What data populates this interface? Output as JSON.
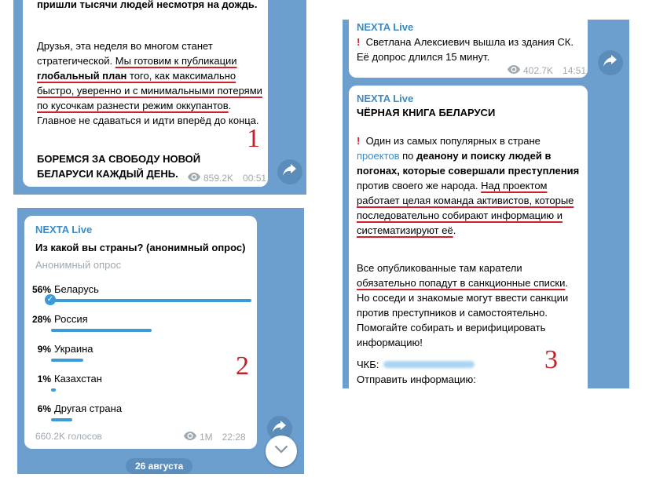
{
  "panel1": {
    "line_cut": "пришли тысячи людей несмотря на дождь.",
    "para1": {
      "t1": "Друзья, эта неделя во многом станет стратегической. ",
      "t2": "Мы готовим к публикации ",
      "t3": "глобальный план",
      "t4": " того, как максимально быстро, уверенно и с минимальными потерями по кусочкам разнести режим оккупантов",
      "t5": ". Главное не сдаваться и идти вперёд до конца."
    },
    "para2": "БОРЕМСЯ ЗА СВОБОДУ НОВОЙ БЕЛАРУСИ КАЖДЫЙ ДЕНЬ.",
    "views": "859.2K",
    "time": "00:51",
    "mark": "1"
  },
  "panel2": {
    "channel": "NEXTA Live",
    "question": "Из какой вы страны? (анонимный опрос)",
    "poll_type": "Анонимный опрос",
    "options": [
      {
        "pct": "56%",
        "label": "Беларусь",
        "value": 56
      },
      {
        "pct": "28%",
        "label": "Россия",
        "value": 28
      },
      {
        "pct": "9%",
        "label": "Украина",
        "value": 9
      },
      {
        "pct": "1%",
        "label": "Казахстан",
        "value": 1
      },
      {
        "pct": "6%",
        "label": "Другая страна",
        "value": 6
      }
    ],
    "votes": "660.2K голосов",
    "views": "1M",
    "time": "22:28",
    "date_pill": "26 августа",
    "mark": "2"
  },
  "panel3": {
    "msg1": {
      "channel": "NEXTA Live",
      "text": "Светлана Алексиевич вышла из здания СК. Её допрос длился 15 минут.",
      "views": "402.7K",
      "time": "14:51"
    },
    "msg2": {
      "channel": "NEXTA Live",
      "title": "ЧЁРНАЯ КНИГА БЕЛАРУСИ",
      "p1": {
        "t1": "Один из самых популярных в стране ",
        "t2": "проектов",
        "t3": " по ",
        "t4": "деанону и поиску людей в погонах, которые совершали преступления",
        "t5": " против своего же народа. ",
        "t6": "Над проектом работает целая команда активистов, которые последовательно собирают информацию и систематизируют её",
        "t7": "."
      },
      "p2": {
        "t1": "Все опубликованные там каратели ",
        "t2": "обязательно попадут в санкционные списки",
        "t3": ". Но соседи и знакомые могут ввести санкции против преступников и самостоятельно. Помогайте собирать и верифицировать информацию!"
      },
      "ckb": "ЧКБ:",
      "send": "Отправить информацию:"
    },
    "mark": "3"
  },
  "icons": {
    "share": "share-arrow-icon",
    "views": "eye-icon",
    "exclaim": "red-exclamation-icon",
    "check": "check-circle-icon",
    "scroll": "chevron-down-icon"
  },
  "colors": {
    "chat_bg": "#6c9fce",
    "accent": "#3d8bc4",
    "annotation": "#c42026"
  }
}
